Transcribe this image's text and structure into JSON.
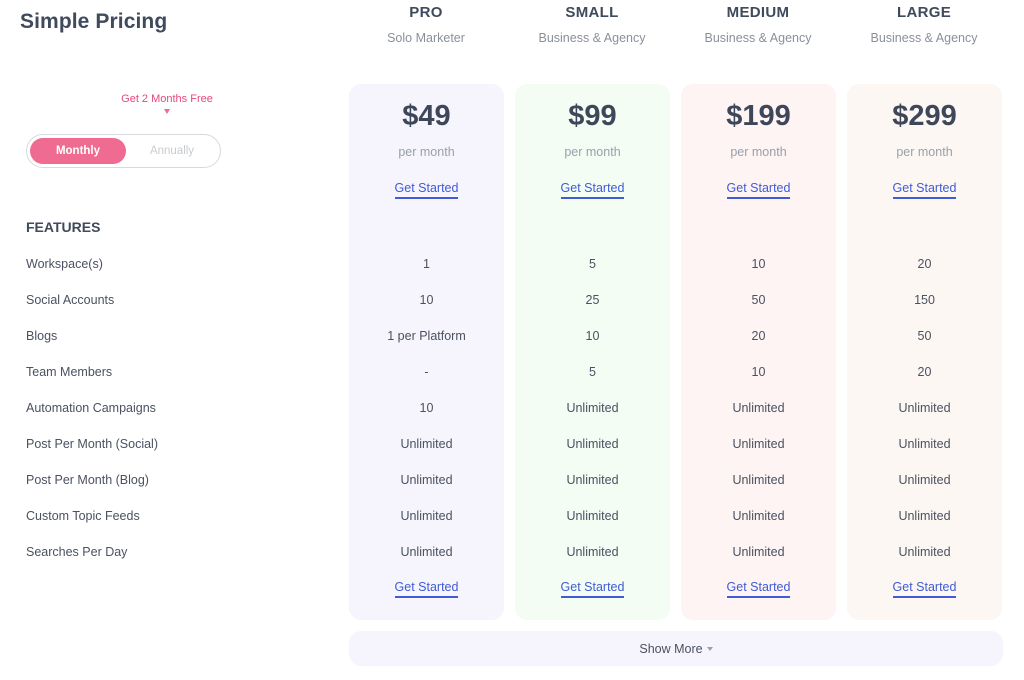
{
  "header": {
    "title": "Simple Pricing"
  },
  "billing": {
    "promo": "Get 2 Months Free",
    "options": [
      "Monthly",
      "Annually"
    ],
    "selected": "Monthly",
    "accent_color": "#ef6b91"
  },
  "features": {
    "heading": "FEATURES",
    "labels": [
      "Workspace(s)",
      "Social Accounts",
      "Blogs",
      "Team Members",
      "Automation Campaigns",
      "Post Per Month (Social)",
      "Post Per Month (Blog)",
      "Custom Topic Feeds",
      "Searches Per Day"
    ]
  },
  "plans": [
    {
      "name": "PRO",
      "subtitle": "Solo Marketer",
      "price": "$49",
      "period": "per month",
      "cta": "Get Started",
      "bg_color": "#f6f5fd",
      "values": [
        "1",
        "10",
        "1 per Platform",
        "-",
        "10",
        "Unlimited",
        "Unlimited",
        "Unlimited",
        "Unlimited"
      ]
    },
    {
      "name": "SMALL",
      "subtitle": "Business & Agency",
      "price": "$99",
      "period": "per month",
      "cta": "Get Started",
      "bg_color": "#f3fdf4",
      "values": [
        "5",
        "25",
        "10",
        "5",
        "Unlimited",
        "Unlimited",
        "Unlimited",
        "Unlimited",
        "Unlimited"
      ]
    },
    {
      "name": "MEDIUM",
      "subtitle": "Business & Agency",
      "price": "$199",
      "period": "per month",
      "cta": "Get Started",
      "bg_color": "#fdf4f3",
      "values": [
        "10",
        "50",
        "20",
        "10",
        "Unlimited",
        "Unlimited",
        "Unlimited",
        "Unlimited",
        "Unlimited"
      ]
    },
    {
      "name": "LARGE",
      "subtitle": "Business & Agency",
      "price": "$299",
      "period": "per month",
      "cta": "Get Started",
      "bg_color": "#fdf7f4",
      "values": [
        "20",
        "150",
        "50",
        "20",
        "Unlimited",
        "Unlimited",
        "Unlimited",
        "Unlimited",
        "Unlimited"
      ]
    }
  ],
  "footer": {
    "show_more": "Show More",
    "cta_color": "#3f5bd6"
  }
}
